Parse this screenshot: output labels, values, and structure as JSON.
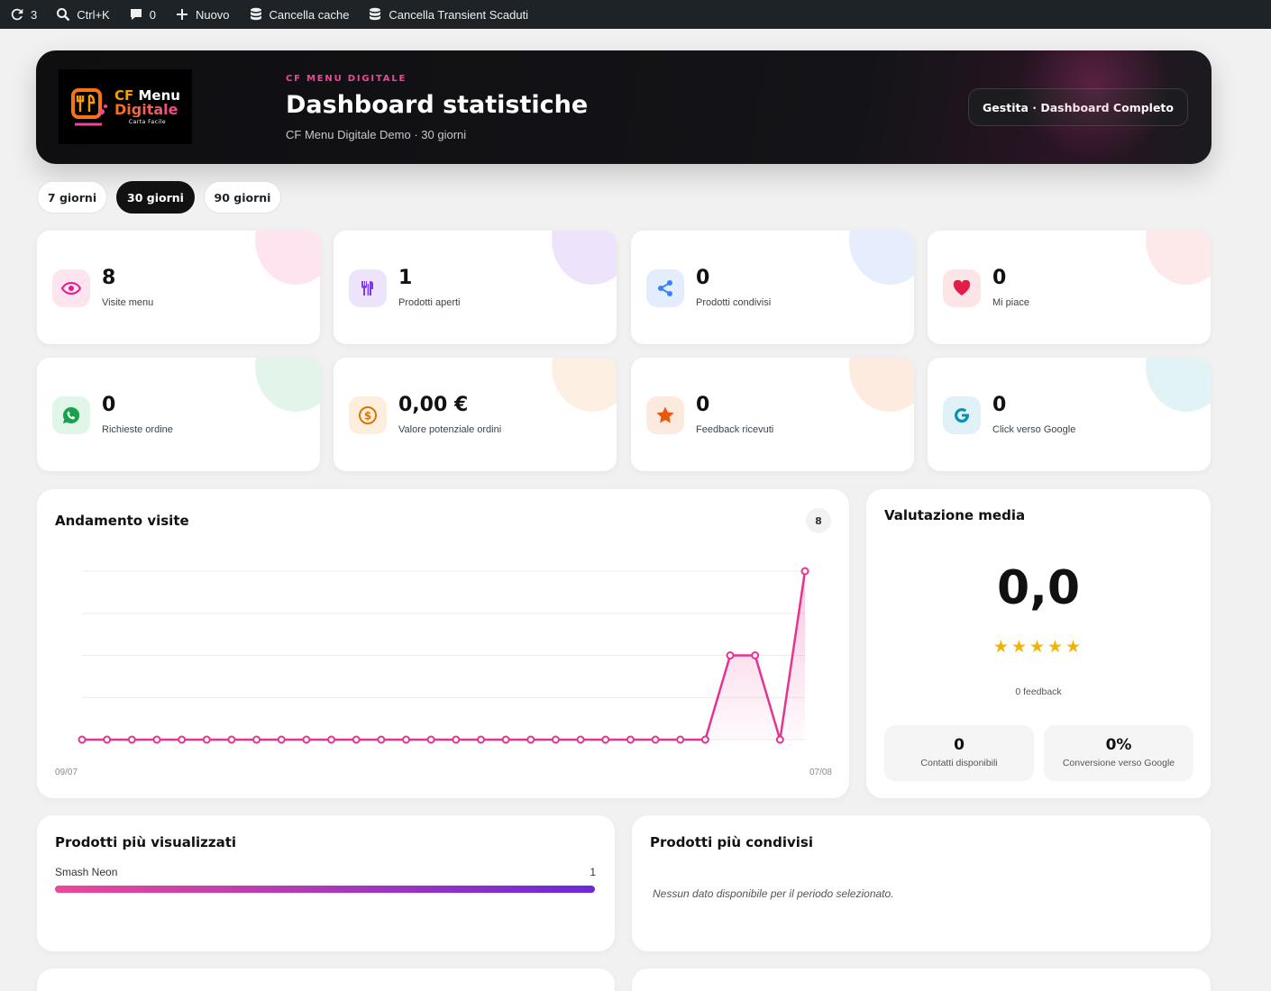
{
  "adminbar": {
    "updates_count": "3",
    "search_shortcut": "Ctrl+K",
    "comments_count": "0",
    "new_label": "Nuovo",
    "clear_cache": "Cancella cache",
    "clear_transients": "Cancella Transient Scaduti"
  },
  "logo": {
    "cf": "CF",
    "menu": "Menu",
    "digitale": "Digitale",
    "tagline": "Carta Facile"
  },
  "hero": {
    "kicker": "CF MENU DIGITALE",
    "title": "Dashboard statistiche",
    "subtitle": "CF Menu Digitale Demo · 30 giorni",
    "button": "Gestita · Dashboard Completo"
  },
  "periods": [
    {
      "label": "7 giorni",
      "active": false
    },
    {
      "label": "30 giorni",
      "active": true
    },
    {
      "label": "90 giorni",
      "active": false
    }
  ],
  "stats": [
    {
      "value": "8",
      "label": "Visite menu",
      "icon": "eye-icon",
      "color": "#e11d8f",
      "bg": "#fde4ef",
      "blob": "#fde4ef"
    },
    {
      "value": "1",
      "label": "Prodotti aperti",
      "icon": "utensils-icon",
      "color": "#7c3aed",
      "bg": "#ede4fb",
      "blob": "#ede4fb"
    },
    {
      "value": "0",
      "label": "Prodotti condivisi",
      "icon": "share-icon",
      "color": "#3b82f6",
      "bg": "#e3edfd",
      "blob": "#e6eefd"
    },
    {
      "value": "0",
      "label": "Mi piace",
      "icon": "heart-icon",
      "color": "#e11d48",
      "bg": "#fde4e6",
      "blob": "#fde8ea"
    },
    {
      "value": "0",
      "label": "Richieste ordine",
      "icon": "whatsapp-icon",
      "color": "#16a34a",
      "bg": "#e1f5e8",
      "blob": "#e3f5ea"
    },
    {
      "value": "0,00 €",
      "label": "Valore potenziale ordini",
      "icon": "dollar-icon",
      "color": "#d97706",
      "bg": "#fdeedd",
      "blob": "#fdf0e2"
    },
    {
      "value": "0",
      "label": "Feedback ricevuti",
      "icon": "star-icon",
      "color": "#ea580c",
      "bg": "#fdeadf",
      "blob": "#fdebe0"
    },
    {
      "value": "0",
      "label": "Click verso Google",
      "icon": "google-icon",
      "color": "#0891b2",
      "bg": "#e0f2f7",
      "blob": "#e2f3f6"
    }
  ],
  "visits": {
    "title": "Andamento visite",
    "total": "8",
    "x_start": "09/07",
    "x_end": "07/08"
  },
  "chart_data": {
    "type": "area",
    "title": "Andamento visite",
    "x_start": "09/07",
    "x_end": "07/08",
    "values": [
      0,
      0,
      0,
      0,
      0,
      0,
      0,
      0,
      0,
      0,
      0,
      0,
      0,
      0,
      0,
      0,
      0,
      0,
      0,
      0,
      0,
      0,
      0,
      0,
      0,
      0,
      2,
      2,
      0,
      4
    ],
    "ylim": [
      0,
      4
    ],
    "grid": true,
    "color": "#e5348f"
  },
  "rating": {
    "title": "Valutazione media",
    "value": "0,0",
    "stars": "★★★★★",
    "feedback": "0 feedback",
    "contacts_value": "0",
    "contacts_label": "Contatti disponibili",
    "conversion_value": "0%",
    "conversion_label": "Conversione verso Google"
  },
  "most_viewed": {
    "title": "Prodotti più visualizzati",
    "items": [
      {
        "name": "Smash Neon",
        "count": "1",
        "fraction": 1.0
      }
    ]
  },
  "most_shared": {
    "title": "Prodotti più condivisi",
    "empty": "Nessun dato disponibile per il periodo selezionato."
  }
}
